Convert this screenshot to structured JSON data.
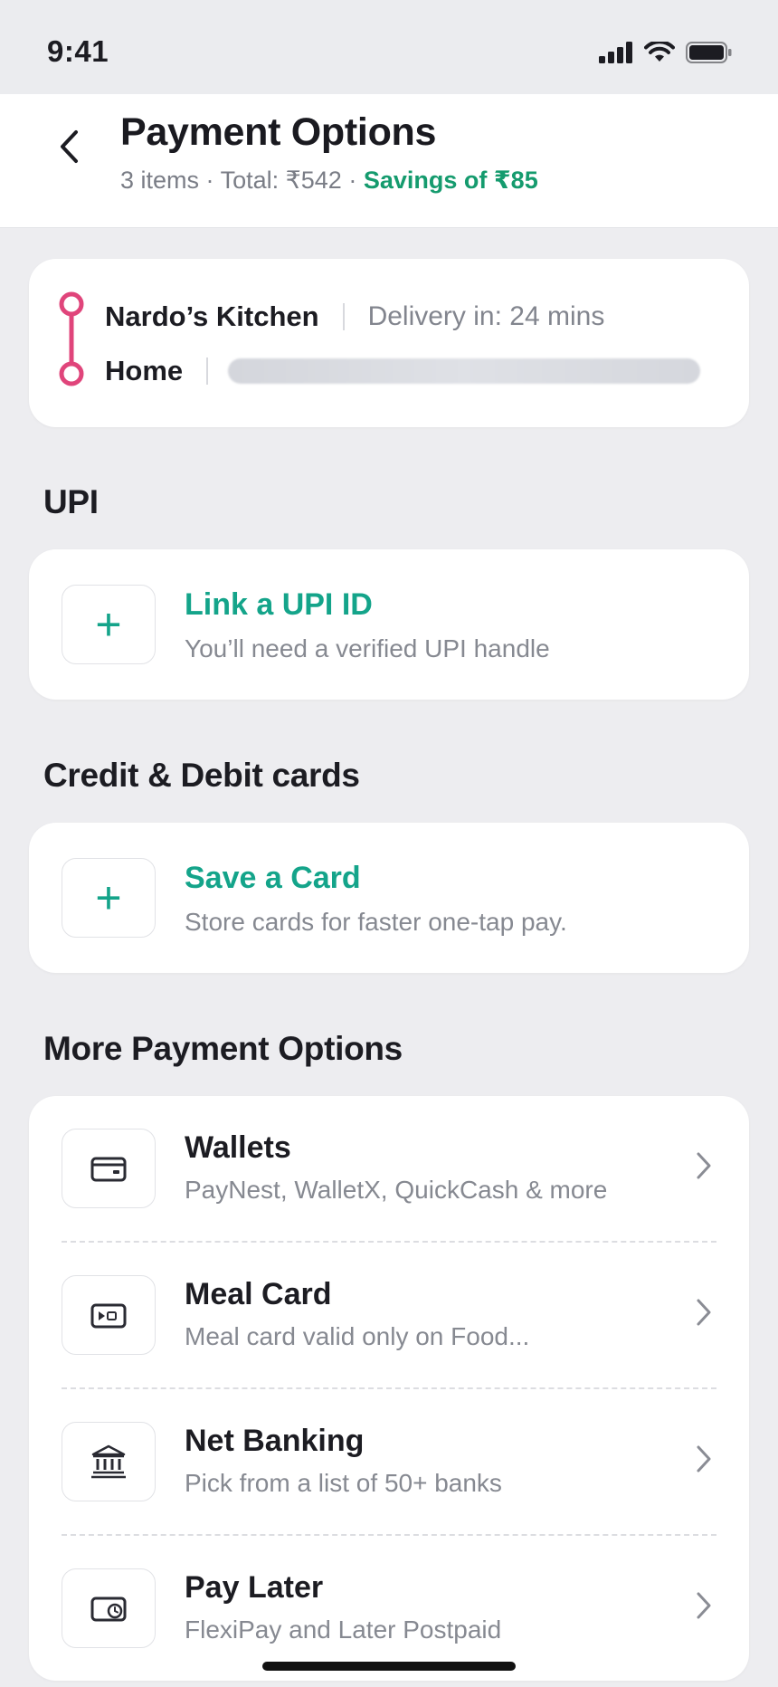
{
  "status_bar": {
    "time": "9:41"
  },
  "header": {
    "title": "Payment Options",
    "items": "3 items",
    "total": "Total: ₹542",
    "savings": "Savings of ₹85",
    "separator": "·"
  },
  "route": {
    "restaurant": "Nardo’s Kitchen",
    "delivery": "Delivery in: 24 mins",
    "destination": "Home",
    "accent_color": "#e0457b"
  },
  "upi": {
    "section_title": "UPI",
    "title": "Link a UPI ID",
    "subtitle": "You’ll need a verified UPI handle"
  },
  "cards": {
    "section_title": "Credit & Debit cards",
    "title": "Save a Card",
    "subtitle": "Store cards for faster one-tap pay."
  },
  "more": {
    "section_title": "More Payment Options",
    "options": [
      {
        "title": "Wallets",
        "subtitle": "PayNest, WalletX, QuickCash & more",
        "icon": "wallet-icon"
      },
      {
        "title": "Meal Card",
        "subtitle": "Meal card valid only on Food...",
        "icon": "meal-card-icon"
      },
      {
        "title": "Net Banking",
        "subtitle": "Pick from a list of 50+ banks",
        "icon": "bank-icon"
      },
      {
        "title": "Pay Later",
        "subtitle": "FlexiPay and Later Postpaid",
        "icon": "pay-later-icon"
      }
    ]
  },
  "colors": {
    "accent_green": "#14a48a",
    "savings_green": "#159b6e",
    "background": "#ededf0"
  }
}
